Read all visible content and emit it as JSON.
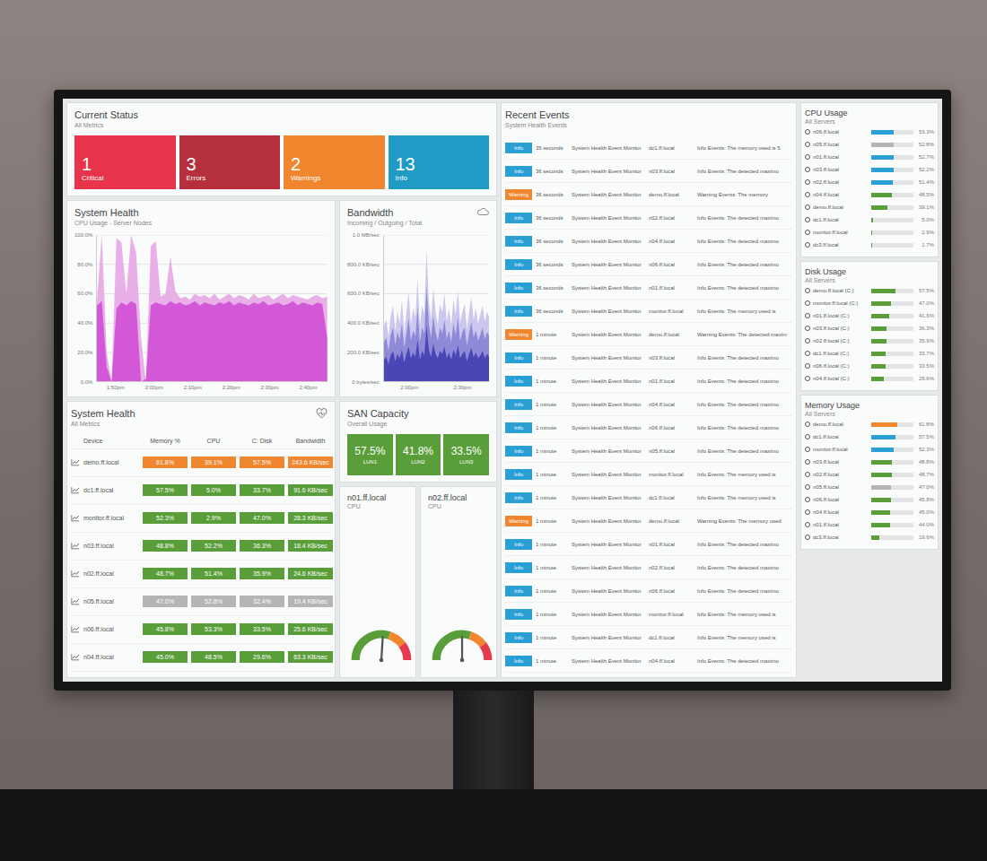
{
  "current_status": {
    "title": "Current Status",
    "subtitle": "All Metrics",
    "cards": [
      {
        "count": "1",
        "label": "Critical",
        "color": "#e8344a"
      },
      {
        "count": "3",
        "label": "Errors",
        "color": "#b52f3d"
      },
      {
        "count": "2",
        "label": "Warnings",
        "color": "#f0862e"
      },
      {
        "count": "13",
        "label": "Info",
        "color": "#1f9bc6"
      }
    ]
  },
  "cpu_chart": {
    "title": "System Health",
    "subtitle": "CPU Usage - Server Nodes",
    "y_ticks": [
      "100.0%",
      "80.0%",
      "60.0%",
      "40.0%",
      "20.0%",
      "0.0%"
    ],
    "x_ticks": [
      "1:50pm",
      "2:00pm",
      "2:10pm",
      "2:20pm",
      "2:30pm",
      "2:40pm"
    ],
    "series": [
      {
        "color": "#e6a6e6",
        "values": [
          55,
          100,
          20,
          0,
          98,
          95,
          60,
          100,
          88,
          30,
          0,
          92,
          96,
          58,
          60,
          85,
          62,
          57,
          58,
          56,
          60,
          58,
          59,
          57,
          60,
          56,
          58,
          60,
          57,
          59,
          58,
          56,
          60,
          57,
          58,
          59,
          56,
          58,
          60,
          57,
          59,
          58,
          57,
          56,
          58,
          59,
          57,
          58
        ]
      },
      {
        "color": "#d04fd6",
        "values": [
          52,
          55,
          10,
          0,
          50,
          54,
          52,
          55,
          53,
          0,
          2,
          52,
          54,
          53,
          52,
          55,
          53,
          54,
          52,
          53,
          55,
          52,
          54,
          53,
          52,
          54,
          53,
          55,
          52,
          54,
          53,
          52,
          54,
          53,
          55,
          52,
          53,
          54,
          52,
          53,
          55,
          52,
          54,
          53,
          52,
          54,
          53,
          30
        ]
      }
    ]
  },
  "bandwidth_chart": {
    "title": "Bandwidth",
    "subtitle": "Incoming / Outgoing / Total",
    "y_ticks": [
      "1.0 MB/sec",
      "800.0 KB/sec",
      "600.0 KB/sec",
      "400.0 KB/sec",
      "200.0 KB/sec",
      "0 bytes/sec"
    ],
    "x_ticks": [
      "2:00pm",
      "2:30pm"
    ],
    "series": [
      {
        "color": "#cbc7ee",
        "values": [
          380,
          420,
          300,
          450,
          520,
          350,
          480,
          400,
          560,
          330,
          470,
          610,
          390,
          500,
          440,
          700,
          380,
          520,
          460,
          900,
          550,
          420,
          640,
          480,
          390,
          530,
          470,
          600,
          410,
          500,
          380,
          560,
          450,
          620,
          400,
          480,
          530,
          360,
          470,
          580,
          420,
          500,
          390,
          460,
          520,
          410,
          480,
          440
        ]
      },
      {
        "color": "#8f8ad8",
        "values": [
          270,
          300,
          210,
          320,
          370,
          250,
          340,
          290,
          400,
          230,
          330,
          430,
          280,
          350,
          310,
          500,
          270,
          370,
          330,
          650,
          390,
          300,
          450,
          340,
          280,
          370,
          330,
          420,
          290,
          350,
          270,
          400,
          320,
          440,
          280,
          340,
          370,
          250,
          330,
          410,
          300,
          350,
          280,
          320,
          370,
          290,
          340,
          310
        ]
      },
      {
        "color": "#4a46b6",
        "values": [
          150,
          170,
          120,
          180,
          210,
          140,
          190,
          160,
          220,
          130,
          190,
          240,
          160,
          200,
          170,
          290,
          150,
          210,
          180,
          380,
          220,
          170,
          260,
          190,
          160,
          210,
          190,
          240,
          160,
          200,
          150,
          220,
          180,
          250,
          160,
          190,
          210,
          140,
          190,
          230,
          170,
          200,
          160,
          180,
          210,
          160,
          190,
          170
        ]
      }
    ]
  },
  "health_table": {
    "title": "System Health",
    "subtitle": "All Metrics",
    "columns": [
      "Device",
      "Memory %",
      "CPU",
      "C: Disk",
      "Bandwidth"
    ],
    "rows": [
      {
        "device": "demo.ff.local",
        "color": "#f0862e",
        "cells": [
          "61.8%",
          "39.1%",
          "57.5%",
          "243.6 KB/sec"
        ]
      },
      {
        "device": "dc1.ff.local",
        "color": "#5a9e3a",
        "cells": [
          "57.5%",
          "5.0%",
          "33.7%",
          "91.6 KB/sec"
        ]
      },
      {
        "device": "monitor.ff.local",
        "color": "#5a9e3a",
        "cells": [
          "52.3%",
          "2.9%",
          "47.0%",
          "28.3 KB/sec"
        ]
      },
      {
        "device": "n03.ff.local",
        "color": "#5a9e3a",
        "cells": [
          "48.8%",
          "52.2%",
          "36.3%",
          "18.4 KB/sec"
        ]
      },
      {
        "device": "n02.ff.local",
        "color": "#5a9e3a",
        "cells": [
          "48.7%",
          "51.4%",
          "35.9%",
          "24.6 KB/sec"
        ]
      },
      {
        "device": "n05.ff.local",
        "color": "#b5b5b5",
        "cells": [
          "47.0%",
          "52.8%",
          "32.4%",
          "19.4 KB/sec"
        ]
      },
      {
        "device": "n06.ff.local",
        "color": "#5a9e3a",
        "cells": [
          "45.8%",
          "53.3%",
          "33.5%",
          "25.6 KB/sec"
        ]
      },
      {
        "device": "n04.ff.local",
        "color": "#5a9e3a",
        "cells": [
          "45.0%",
          "48.5%",
          "29.6%",
          "63.3 KB/sec"
        ]
      }
    ]
  },
  "san": {
    "title": "SAN Capacity",
    "subtitle": "Overall Usage",
    "luns": [
      {
        "value": "57.5%",
        "label": "LUN1"
      },
      {
        "value": "41.8%",
        "label": "LUN2"
      },
      {
        "value": "33.5%",
        "label": "LUN3"
      }
    ]
  },
  "gauges": [
    {
      "title": "n01.ff.local",
      "subtitle": "CPU",
      "level": 0.52
    },
    {
      "title": "n02.ff.local",
      "subtitle": "CPU",
      "level": 0.5
    }
  ],
  "events": {
    "title": "Recent Events",
    "subtitle": "System Health Events",
    "rows": [
      {
        "level": "Info",
        "color": "#2a9fd6",
        "time": "35 seconds",
        "source": "System Health Event Monitor",
        "host": "dc1.ff.local",
        "message": "Info Events: The memory used is 5"
      },
      {
        "level": "Info",
        "color": "#2a9fd6",
        "time": "36 seconds",
        "source": "System Health Event Monitor",
        "host": "n03.ff.local",
        "message": "Info Events: The detected maximu"
      },
      {
        "level": "Warning",
        "color": "#f0862e",
        "time": "36 seconds",
        "source": "System Health Event Monitor",
        "host": "demo.ff.local",
        "message": "Warning Events: The memory"
      },
      {
        "level": "Info",
        "color": "#2a9fd6",
        "time": "36 seconds",
        "source": "System Health Event Monitor",
        "host": "n02.ff.local",
        "message": "Info Events: The detected maximu"
      },
      {
        "level": "Info",
        "color": "#2a9fd6",
        "time": "36 seconds",
        "source": "System Health Event Monitor",
        "host": "n04.ff.local",
        "message": "Info Events: The detected maximu"
      },
      {
        "level": "Info",
        "color": "#2a9fd6",
        "time": "36 seconds",
        "source": "System Health Event Monitor",
        "host": "n06.ff.local",
        "message": "Info Events: The detected maximu"
      },
      {
        "level": "Info",
        "color": "#2a9fd6",
        "time": "36 seconds",
        "source": "System Health Event Monitor",
        "host": "n01.ff.local",
        "message": "Info Events: The detected maximu"
      },
      {
        "level": "Info",
        "color": "#2a9fd6",
        "time": "36 seconds",
        "source": "System Health Event Monitor",
        "host": "monitor.ff.local",
        "message": "Info Events: The memory used is"
      },
      {
        "level": "Warning",
        "color": "#f0862e",
        "time": "1 minute",
        "source": "System Health Event Monitor",
        "host": "demo.ff.local",
        "message": "Warning Events: The detected maxim"
      },
      {
        "level": "Info",
        "color": "#2a9fd6",
        "time": "1 minute",
        "source": "System Health Event Monitor",
        "host": "n03.ff.local",
        "message": "Info Events: The detected maximu"
      },
      {
        "level": "Info",
        "color": "#2a9fd6",
        "time": "1 minute",
        "source": "System Health Event Monitor",
        "host": "n01.ff.local",
        "message": "Info Events: The detected maximu"
      },
      {
        "level": "Info",
        "color": "#2a9fd6",
        "time": "1 minute",
        "source": "System Health Event Monitor",
        "host": "n04.ff.local",
        "message": "Info Events: The detected maximu"
      },
      {
        "level": "Info",
        "color": "#2a9fd6",
        "time": "1 minute",
        "source": "System Health Event Monitor",
        "host": "n06.ff.local",
        "message": "Info Events: The detected maximu"
      },
      {
        "level": "Info",
        "color": "#2a9fd6",
        "time": "1 minute",
        "source": "System Health Event Monitor",
        "host": "n05.ff.local",
        "message": "Info Events: The detected maximu"
      },
      {
        "level": "Info",
        "color": "#2a9fd6",
        "time": "1 minute",
        "source": "System Health Event Monitor",
        "host": "monitor.ff.local",
        "message": "Info Events: The memory used is"
      },
      {
        "level": "Info",
        "color": "#2a9fd6",
        "time": "1 minute",
        "source": "System Health Event Monitor",
        "host": "dc1.ff.local",
        "message": "Info Events: The memory used is"
      },
      {
        "level": "Warning",
        "color": "#f0862e",
        "time": "1 minute",
        "source": "System Health Event Monitor",
        "host": "demo.ff.local",
        "message": "Warning Events: The memory used"
      },
      {
        "level": "Info",
        "color": "#2a9fd6",
        "time": "1 minute",
        "source": "System Health Event Monitor",
        "host": "n01.ff.local",
        "message": "Info Events: The detected maximu"
      },
      {
        "level": "Info",
        "color": "#2a9fd6",
        "time": "1 minute",
        "source": "System Health Event Monitor",
        "host": "n02.ff.local",
        "message": "Info Events: The detected maximu"
      },
      {
        "level": "Info",
        "color": "#2a9fd6",
        "time": "1 minute",
        "source": "System Health Event Monitor",
        "host": "n06.ff.local",
        "message": "Info Events: The detected maximu"
      },
      {
        "level": "Info",
        "color": "#2a9fd6",
        "time": "1 minute",
        "source": "System Health Event Monitor",
        "host": "monitor.ff.local",
        "message": "Info Events: The memory used is"
      },
      {
        "level": "Info",
        "color": "#2a9fd6",
        "time": "1 minute",
        "source": "System Health Event Monitor",
        "host": "dc1.ff.local",
        "message": "Info Events: The memory used is"
      },
      {
        "level": "Info",
        "color": "#2a9fd6",
        "time": "1 minute",
        "source": "System Health Event Monitor",
        "host": "n04.ff.local",
        "message": "Info Events: The detected maximu"
      }
    ]
  },
  "usage_panels": [
    {
      "title": "CPU Usage",
      "subtitle": "All Servers",
      "rows": [
        {
          "host": "n06.ff.local",
          "value": "53.3%",
          "level": 0.533,
          "color": "#2a9fd6"
        },
        {
          "host": "n05.ff.local",
          "value": "52.8%",
          "level": 0.528,
          "color": "#b5b5b5"
        },
        {
          "host": "n01.ff.local",
          "value": "52.7%",
          "level": 0.527,
          "color": "#2a9fd6"
        },
        {
          "host": "n03.ff.local",
          "value": "52.2%",
          "level": 0.522,
          "color": "#2a9fd6"
        },
        {
          "host": "n02.ff.local",
          "value": "51.4%",
          "level": 0.514,
          "color": "#2a9fd6"
        },
        {
          "host": "n04.ff.local",
          "value": "48.5%",
          "level": 0.485,
          "color": "#5a9e3a"
        },
        {
          "host": "demo.ff.local",
          "value": "39.1%",
          "level": 0.391,
          "color": "#5a9e3a"
        },
        {
          "host": "dc1.ff.local",
          "value": "5.0%",
          "level": 0.05,
          "color": "#5a9e3a"
        },
        {
          "host": "monitor.ff.local",
          "value": "2.9%",
          "level": 0.029,
          "color": "#5a9e3a"
        },
        {
          "host": "dc3.ff.local",
          "value": "1.7%",
          "level": 0.017,
          "color": "#5a9e3a"
        }
      ]
    },
    {
      "title": "Disk Usage",
      "subtitle": "All Servers",
      "rows": [
        {
          "host": "demo.ff.local (C:)",
          "value": "57.5%",
          "level": 0.575,
          "color": "#5a9e3a"
        },
        {
          "host": "monitor.ff.local (C:)",
          "value": "47.0%",
          "level": 0.47,
          "color": "#5a9e3a"
        },
        {
          "host": "n01.ff.local (C:)",
          "value": "41.6%",
          "level": 0.416,
          "color": "#5a9e3a"
        },
        {
          "host": "n03.ff.local (C:)",
          "value": "36.3%",
          "level": 0.363,
          "color": "#5a9e3a"
        },
        {
          "host": "n02.ff.local (C:)",
          "value": "35.9%",
          "level": 0.359,
          "color": "#5a9e3a"
        },
        {
          "host": "dc1.ff.local (C:)",
          "value": "33.7%",
          "level": 0.337,
          "color": "#5a9e3a"
        },
        {
          "host": "n06.ff.local (C:)",
          "value": "33.5%",
          "level": 0.335,
          "color": "#5a9e3a"
        },
        {
          "host": "n04.ff.local (C:)",
          "value": "29.6%",
          "level": 0.296,
          "color": "#5a9e3a"
        }
      ]
    },
    {
      "title": "Memory Usage",
      "subtitle": "All Servers",
      "rows": [
        {
          "host": "demo.ff.local",
          "value": "61.8%",
          "level": 0.618,
          "color": "#f0862e"
        },
        {
          "host": "dc1.ff.local",
          "value": "57.5%",
          "level": 0.575,
          "color": "#2a9fd6"
        },
        {
          "host": "monitor.ff.local",
          "value": "52.3%",
          "level": 0.523,
          "color": "#2a9fd6"
        },
        {
          "host": "n03.ff.local",
          "value": "48.8%",
          "level": 0.488,
          "color": "#5a9e3a"
        },
        {
          "host": "n02.ff.local",
          "value": "48.7%",
          "level": 0.487,
          "color": "#5a9e3a"
        },
        {
          "host": "n05.ff.local",
          "value": "47.0%",
          "level": 0.47,
          "color": "#b5b5b5"
        },
        {
          "host": "n06.ff.local",
          "value": "45.8%",
          "level": 0.458,
          "color": "#5a9e3a"
        },
        {
          "host": "n04.ff.local",
          "value": "45.0%",
          "level": 0.45,
          "color": "#5a9e3a"
        },
        {
          "host": "n01.ff.local",
          "value": "44.0%",
          "level": 0.44,
          "color": "#5a9e3a"
        },
        {
          "host": "dc3.ff.local",
          "value": "19.6%",
          "level": 0.196,
          "color": "#5a9e3a"
        }
      ]
    }
  ]
}
